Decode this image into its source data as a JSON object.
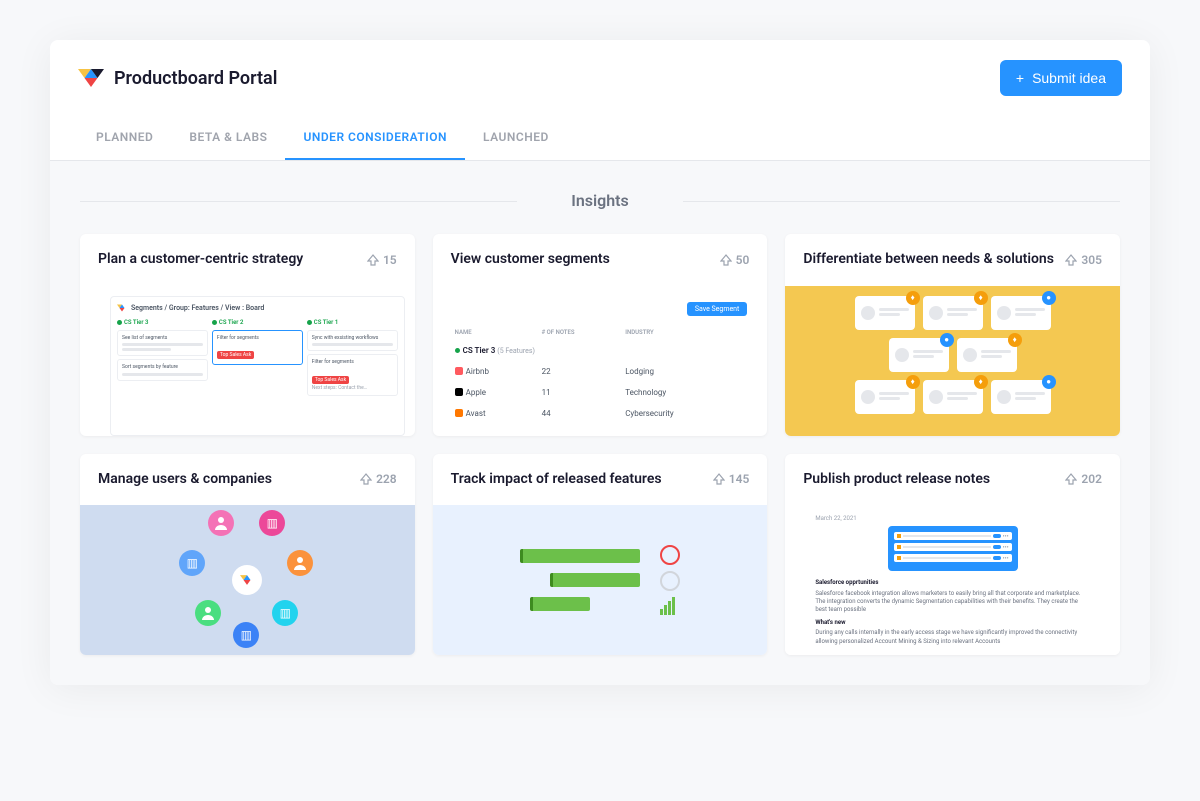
{
  "header": {
    "title": "Productboard Portal",
    "submit_label": "Submit idea"
  },
  "tabs": [
    {
      "label": "PLANNED",
      "active": false
    },
    {
      "label": "BETA & LABS",
      "active": false
    },
    {
      "label": "UNDER CONSIDERATION",
      "active": true
    },
    {
      "label": "LAUNCHED",
      "active": false
    }
  ],
  "section_title": "Insights",
  "cards": {
    "strategy": {
      "title": "Plan a customer-centric strategy",
      "votes": "15",
      "breadcrumb": "Segments / Group: Features / View : Board",
      "cols": [
        "CS Tier 3",
        "CS Tier 2",
        "CS Tier 1"
      ],
      "tiles": {
        "c0t0": "See list of segments",
        "c0t1": "Sort segments by feature",
        "c1t0": "Filter for segments",
        "chip": "Top Sales Ask",
        "c2t0": "Sync with exsisting workflows",
        "c2t1": "Filter for segments",
        "c2foot": "Next steps: Contact the…"
      }
    },
    "segments": {
      "title": "View customer segments",
      "votes": "50",
      "save_label": "Save Segment",
      "columns": {
        "name": "NAME",
        "notes": "# OF NOTES",
        "industry": "INDUSTRY"
      },
      "group": {
        "name": "CS Tier 3",
        "sub": "(5 Features)"
      },
      "rows": [
        {
          "name": "Airbnb",
          "notes": "22",
          "industry": "Lodging"
        },
        {
          "name": "Apple",
          "notes": "11",
          "industry": "Technology"
        },
        {
          "name": "Avast",
          "notes": "44",
          "industry": "Cybersecurity"
        }
      ]
    },
    "needs": {
      "title": "Differentiate between needs & solutions",
      "votes": "305"
    },
    "users": {
      "title": "Manage users & companies",
      "votes": "228"
    },
    "impact": {
      "title": "Track impact of released features",
      "votes": "145"
    },
    "notes": {
      "title": "Publish product release notes",
      "votes": "202",
      "date": "March 22, 2021",
      "heading": "Salesforce opprtunities",
      "body": "Salesforce facebook integration allows marketers to easily bring all that corporate and marketplace. The integration converts the dynamic Segmentation capabilities with their benefits. They create the best team possible",
      "heading2": "What's new",
      "body2": "During any calls internally in the early access stage we have significantly improved the connectivity allowing personalized Account Mining & Sizing into relevant Accounts"
    }
  }
}
